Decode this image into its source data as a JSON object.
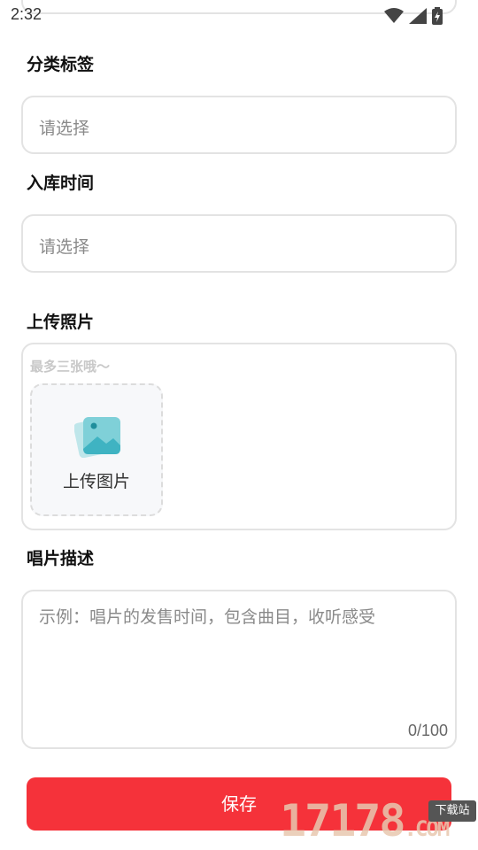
{
  "status_bar": {
    "time": "2:32"
  },
  "form": {
    "category": {
      "label": "分类标签",
      "placeholder": "请选择"
    },
    "storage_time": {
      "label": "入库时间",
      "placeholder": "请选择"
    },
    "photos": {
      "label": "上传照片",
      "hint": "最多三张哦～",
      "upload_label": "上传图片",
      "max_count": 3
    },
    "description": {
      "label": "唱片描述",
      "placeholder": "示例：唱片的发售时间，包含曲目，收听感受",
      "counter": "0/100",
      "max_length": 100
    }
  },
  "save_label": "保存",
  "watermark": {
    "main": "17178",
    "suffix": ".COM",
    "badge": "下载站"
  },
  "colors": {
    "accent": "#f5323a",
    "border": "#e3e3e3",
    "placeholder": "#8a8a8a",
    "upload_bg": "#f7f8fa",
    "icon_teal": "#3fb3c2"
  },
  "icons": [
    "wifi-icon",
    "signal-icon",
    "battery-icon",
    "image-icon"
  ]
}
